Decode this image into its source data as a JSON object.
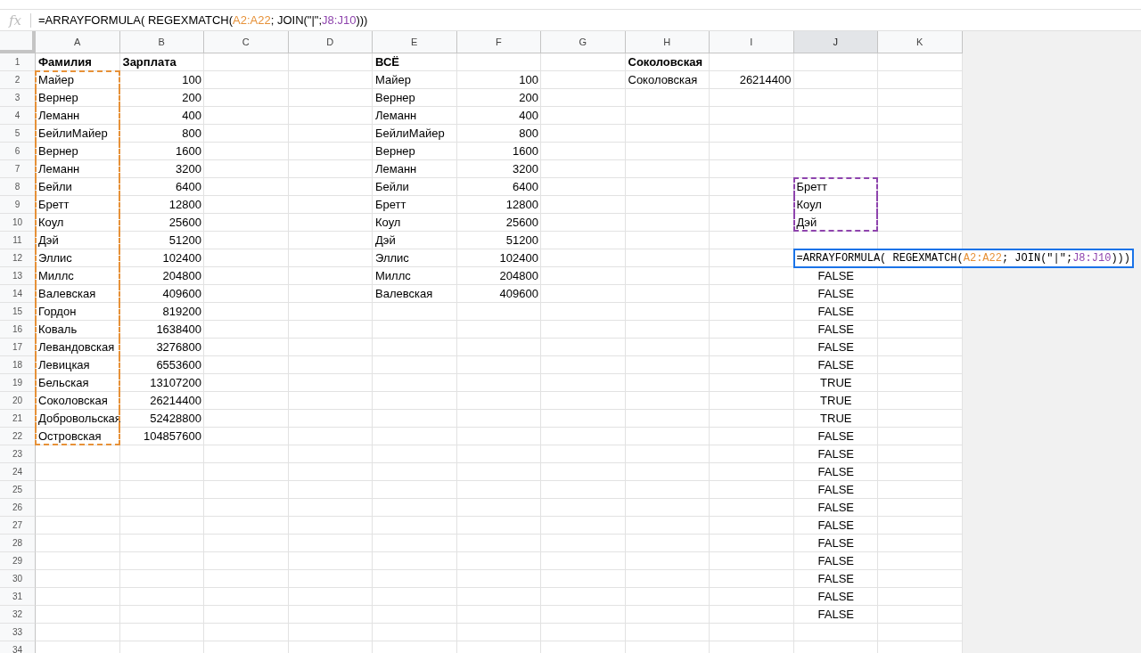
{
  "formula_bar": {
    "icon": "fx",
    "segments": [
      {
        "text": "=ARRAYFORMULA( REGEXMATCH("
      },
      {
        "text": "A2:A22",
        "color": "#e69138"
      },
      {
        "text": "; JOIN(\"|\";"
      },
      {
        "text": "J8:J10",
        "color": "#8e44ad"
      },
      {
        "text": ")))"
      }
    ]
  },
  "columns": [
    {
      "label": "A",
      "selected": false
    },
    {
      "label": "B",
      "selected": false
    },
    {
      "label": "C",
      "selected": false
    },
    {
      "label": "D",
      "selected": false
    },
    {
      "label": "E",
      "selected": false
    },
    {
      "label": "F",
      "selected": false
    },
    {
      "label": "G",
      "selected": false
    },
    {
      "label": "H",
      "selected": false
    },
    {
      "label": "I",
      "selected": false
    },
    {
      "label": "J",
      "selected": true
    },
    {
      "label": "K",
      "selected": false
    }
  ],
  "rows": [
    {
      "number": "1",
      "cells": [
        {
          "text": "Фамилия",
          "kind": "header"
        },
        {
          "text": "Зарплата",
          "kind": "header"
        },
        null,
        null,
        {
          "text": "ВСЁ",
          "kind": "header"
        },
        null,
        null,
        {
          "text": "Соколовская",
          "kind": "header"
        },
        null,
        null,
        null
      ]
    },
    {
      "number": "2",
      "cells": [
        {
          "text": "Майер",
          "kind": "text",
          "color": "#e69138"
        },
        {
          "text": "100",
          "kind": "number"
        },
        null,
        null,
        {
          "text": "Майер",
          "kind": "text"
        },
        {
          "text": "100",
          "kind": "number"
        },
        null,
        {
          "text": "Соколовская",
          "kind": "text"
        },
        {
          "text": "26214400",
          "kind": "number"
        },
        null,
        null
      ]
    },
    {
      "number": "3",
      "cells": [
        {
          "text": "Вернер",
          "kind": "text",
          "color": "#e69138"
        },
        {
          "text": "200",
          "kind": "number"
        },
        null,
        null,
        {
          "text": "Вернер",
          "kind": "text"
        },
        {
          "text": "200",
          "kind": "number"
        },
        null,
        null,
        null,
        null,
        null
      ]
    },
    {
      "number": "4",
      "cells": [
        {
          "text": "Леманн",
          "kind": "text",
          "color": "#e69138"
        },
        {
          "text": "400",
          "kind": "number"
        },
        null,
        null,
        {
          "text": "Леманн",
          "kind": "text"
        },
        {
          "text": "400",
          "kind": "number"
        },
        null,
        null,
        null,
        null,
        null
      ]
    },
    {
      "number": "5",
      "cells": [
        {
          "text": "БейлиМайер",
          "kind": "text",
          "color": "#e69138"
        },
        {
          "text": "800",
          "kind": "number"
        },
        null,
        null,
        {
          "text": "БейлиМайер",
          "kind": "text"
        },
        {
          "text": "800",
          "kind": "number"
        },
        null,
        null,
        null,
        null,
        null
      ]
    },
    {
      "number": "6",
      "cells": [
        {
          "text": "Вернер",
          "kind": "text",
          "color": "#e69138"
        },
        {
          "text": "1600",
          "kind": "number"
        },
        null,
        null,
        {
          "text": "Вернер",
          "kind": "text"
        },
        {
          "text": "1600",
          "kind": "number"
        },
        null,
        null,
        null,
        null,
        null
      ]
    },
    {
      "number": "7",
      "cells": [
        {
          "text": "Леманн",
          "kind": "text",
          "color": "#e69138"
        },
        {
          "text": "3200",
          "kind": "number"
        },
        null,
        null,
        {
          "text": "Леманн",
          "kind": "text"
        },
        {
          "text": "3200",
          "kind": "number"
        },
        null,
        null,
        null,
        null,
        null
      ]
    },
    {
      "number": "8",
      "cells": [
        {
          "text": "Бейли",
          "kind": "text",
          "color": "#e69138"
        },
        {
          "text": "6400",
          "kind": "number"
        },
        null,
        null,
        {
          "text": "Бейли",
          "kind": "text"
        },
        {
          "text": "6400",
          "kind": "number"
        },
        null,
        null,
        null,
        {
          "text": "Бретт",
          "kind": "text",
          "color": "#8e44ad"
        },
        null
      ]
    },
    {
      "number": "9",
      "cells": [
        {
          "text": "Бретт",
          "kind": "text",
          "color": "#e69138"
        },
        {
          "text": "12800",
          "kind": "number"
        },
        null,
        null,
        {
          "text": "Бретт",
          "kind": "text"
        },
        {
          "text": "12800",
          "kind": "number"
        },
        null,
        null,
        null,
        {
          "text": "Коул",
          "kind": "text",
          "color": "#8e44ad"
        },
        null
      ]
    },
    {
      "number": "10",
      "cells": [
        {
          "text": "Коул",
          "kind": "text",
          "color": "#e69138"
        },
        {
          "text": "25600",
          "kind": "number"
        },
        null,
        null,
        {
          "text": "Коул",
          "kind": "text"
        },
        {
          "text": "25600",
          "kind": "number"
        },
        null,
        null,
        null,
        {
          "text": "Дэй",
          "kind": "text",
          "color": "#8e44ad"
        },
        null
      ]
    },
    {
      "number": "11",
      "cells": [
        {
          "text": "Дэй",
          "kind": "text",
          "color": "#e69138"
        },
        {
          "text": "51200",
          "kind": "number"
        },
        null,
        null,
        {
          "text": "Дэй",
          "kind": "text"
        },
        {
          "text": "51200",
          "kind": "number"
        },
        null,
        null,
        null,
        null,
        null
      ]
    },
    {
      "number": "12",
      "cells": [
        {
          "text": "Эллис",
          "kind": "text",
          "color": "#e69138"
        },
        {
          "text": "102400",
          "kind": "number"
        },
        null,
        null,
        {
          "text": "Эллис",
          "kind": "text"
        },
        {
          "text": "102400",
          "kind": "number"
        },
        null,
        null,
        null,
        {
          "kind": "editor",
          "segments": [
            {
              "text": "=ARRAYFORMULA( REGEXMATCH("
            },
            {
              "text": "A2:A22",
              "color": "#e69138"
            },
            {
              "text": "; JOIN(\"|\";"
            },
            {
              "text": "J8:J10",
              "color": "#8e44ad"
            },
            {
              "text": ")))"
            }
          ]
        },
        null
      ]
    },
    {
      "number": "13",
      "cells": [
        {
          "text": "Миллс",
          "kind": "text",
          "color": "#e69138"
        },
        {
          "text": "204800",
          "kind": "number"
        },
        null,
        null,
        {
          "text": "Миллс",
          "kind": "text"
        },
        {
          "text": "204800",
          "kind": "number"
        },
        null,
        null,
        null,
        {
          "text": "FALSE",
          "kind": "boolean"
        },
        null
      ]
    },
    {
      "number": "14",
      "cells": [
        {
          "text": "Валевская",
          "kind": "text",
          "color": "#e69138"
        },
        {
          "text": "409600",
          "kind": "number"
        },
        null,
        null,
        {
          "text": "Валевская",
          "kind": "text"
        },
        {
          "text": "409600",
          "kind": "number"
        },
        null,
        null,
        null,
        {
          "text": "FALSE",
          "kind": "boolean"
        },
        null
      ]
    },
    {
      "number": "15",
      "cells": [
        {
          "text": "Гордон",
          "kind": "text",
          "color": "#e69138"
        },
        {
          "text": "819200",
          "kind": "number"
        },
        null,
        null,
        null,
        null,
        null,
        null,
        null,
        {
          "text": "FALSE",
          "kind": "boolean"
        },
        null
      ]
    },
    {
      "number": "16",
      "cells": [
        {
          "text": "Коваль",
          "kind": "text",
          "color": "#e69138"
        },
        {
          "text": "1638400",
          "kind": "number"
        },
        null,
        null,
        null,
        null,
        null,
        null,
        null,
        {
          "text": "FALSE",
          "kind": "boolean"
        },
        null
      ]
    },
    {
      "number": "17",
      "cells": [
        {
          "text": "Левандовская",
          "kind": "text",
          "color": "#e69138"
        },
        {
          "text": "3276800",
          "kind": "number"
        },
        null,
        null,
        null,
        null,
        null,
        null,
        null,
        {
          "text": "FALSE",
          "kind": "boolean"
        },
        null
      ]
    },
    {
      "number": "18",
      "cells": [
        {
          "text": "Левицкая",
          "kind": "text",
          "color": "#e69138"
        },
        {
          "text": "6553600",
          "kind": "number"
        },
        null,
        null,
        null,
        null,
        null,
        null,
        null,
        {
          "text": "FALSE",
          "kind": "boolean"
        },
        null
      ]
    },
    {
      "number": "19",
      "cells": [
        {
          "text": "Бельская",
          "kind": "text",
          "color": "#e69138"
        },
        {
          "text": "13107200",
          "kind": "number"
        },
        null,
        null,
        null,
        null,
        null,
        null,
        null,
        {
          "text": "TRUE",
          "kind": "boolean"
        },
        null
      ]
    },
    {
      "number": "20",
      "cells": [
        {
          "text": "Соколовская",
          "kind": "text",
          "color": "#e69138"
        },
        {
          "text": "26214400",
          "kind": "number"
        },
        null,
        null,
        null,
        null,
        null,
        null,
        null,
        {
          "text": "TRUE",
          "kind": "boolean"
        },
        null
      ]
    },
    {
      "number": "21",
      "cells": [
        {
          "text": "Добровольская",
          "kind": "text",
          "color": "#e69138"
        },
        {
          "text": "52428800",
          "kind": "number"
        },
        null,
        null,
        null,
        null,
        null,
        null,
        null,
        {
          "text": "TRUE",
          "kind": "boolean"
        },
        null
      ]
    },
    {
      "number": "22",
      "cells": [
        {
          "text": "Островская",
          "kind": "text",
          "color": "#e69138"
        },
        {
          "text": "104857600",
          "kind": "number"
        },
        null,
        null,
        null,
        null,
        null,
        null,
        null,
        {
          "text": "FALSE",
          "kind": "boolean"
        },
        null
      ]
    },
    {
      "number": "23",
      "cells": [
        null,
        null,
        null,
        null,
        null,
        null,
        null,
        null,
        null,
        {
          "text": "FALSE",
          "kind": "boolean"
        },
        null
      ]
    },
    {
      "number": "24",
      "cells": [
        null,
        null,
        null,
        null,
        null,
        null,
        null,
        null,
        null,
        {
          "text": "FALSE",
          "kind": "boolean"
        },
        null
      ]
    },
    {
      "number": "25",
      "cells": [
        null,
        null,
        null,
        null,
        null,
        null,
        null,
        null,
        null,
        {
          "text": "FALSE",
          "kind": "boolean"
        },
        null
      ]
    },
    {
      "number": "26",
      "cells": [
        null,
        null,
        null,
        null,
        null,
        null,
        null,
        null,
        null,
        {
          "text": "FALSE",
          "kind": "boolean"
        },
        null
      ]
    },
    {
      "number": "27",
      "cells": [
        null,
        null,
        null,
        null,
        null,
        null,
        null,
        null,
        null,
        {
          "text": "FALSE",
          "kind": "boolean"
        },
        null
      ]
    },
    {
      "number": "28",
      "cells": [
        null,
        null,
        null,
        null,
        null,
        null,
        null,
        null,
        null,
        {
          "text": "FALSE",
          "kind": "boolean"
        },
        null
      ]
    },
    {
      "number": "29",
      "cells": [
        null,
        null,
        null,
        null,
        null,
        null,
        null,
        null,
        null,
        {
          "text": "FALSE",
          "kind": "boolean"
        },
        null
      ]
    },
    {
      "number": "30",
      "cells": [
        null,
        null,
        null,
        null,
        null,
        null,
        null,
        null,
        null,
        {
          "text": "FALSE",
          "kind": "boolean"
        },
        null
      ]
    },
    {
      "number": "31",
      "cells": [
        null,
        null,
        null,
        null,
        null,
        null,
        null,
        null,
        null,
        {
          "text": "FALSE",
          "kind": "boolean"
        },
        null
      ]
    },
    {
      "number": "32",
      "cells": [
        null,
        null,
        null,
        null,
        null,
        null,
        null,
        null,
        null,
        {
          "text": "FALSE",
          "kind": "boolean"
        },
        null
      ]
    },
    {
      "number": "33"
    },
    {
      "number": "34"
    }
  ]
}
